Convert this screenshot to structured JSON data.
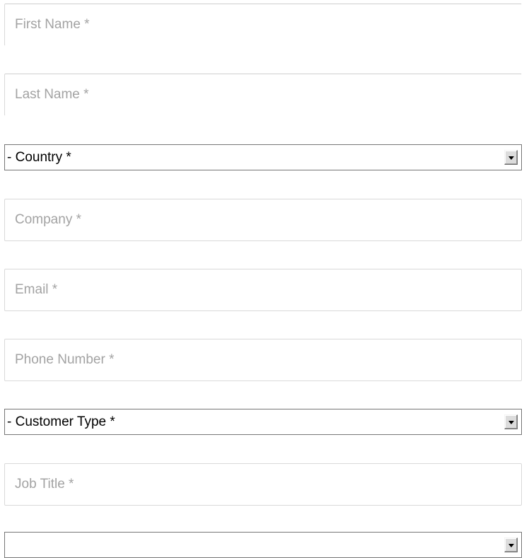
{
  "form": {
    "first_name": {
      "placeholder": "First Name *",
      "value": ""
    },
    "last_name": {
      "placeholder": "Last Name *",
      "value": ""
    },
    "country": {
      "selected": "- Country *",
      "icon": "dropdown-arrow-icon"
    },
    "company": {
      "placeholder": "Company *",
      "value": ""
    },
    "email": {
      "placeholder": "Email *",
      "value": ""
    },
    "phone": {
      "placeholder": "Phone Number *",
      "value": ""
    },
    "customer_type": {
      "selected": "- Customer Type *",
      "icon": "dropdown-arrow-icon"
    },
    "job_title": {
      "placeholder": "Job Title *",
      "value": ""
    },
    "next_select": {
      "selected": "",
      "icon": "dropdown-arrow-icon"
    }
  }
}
